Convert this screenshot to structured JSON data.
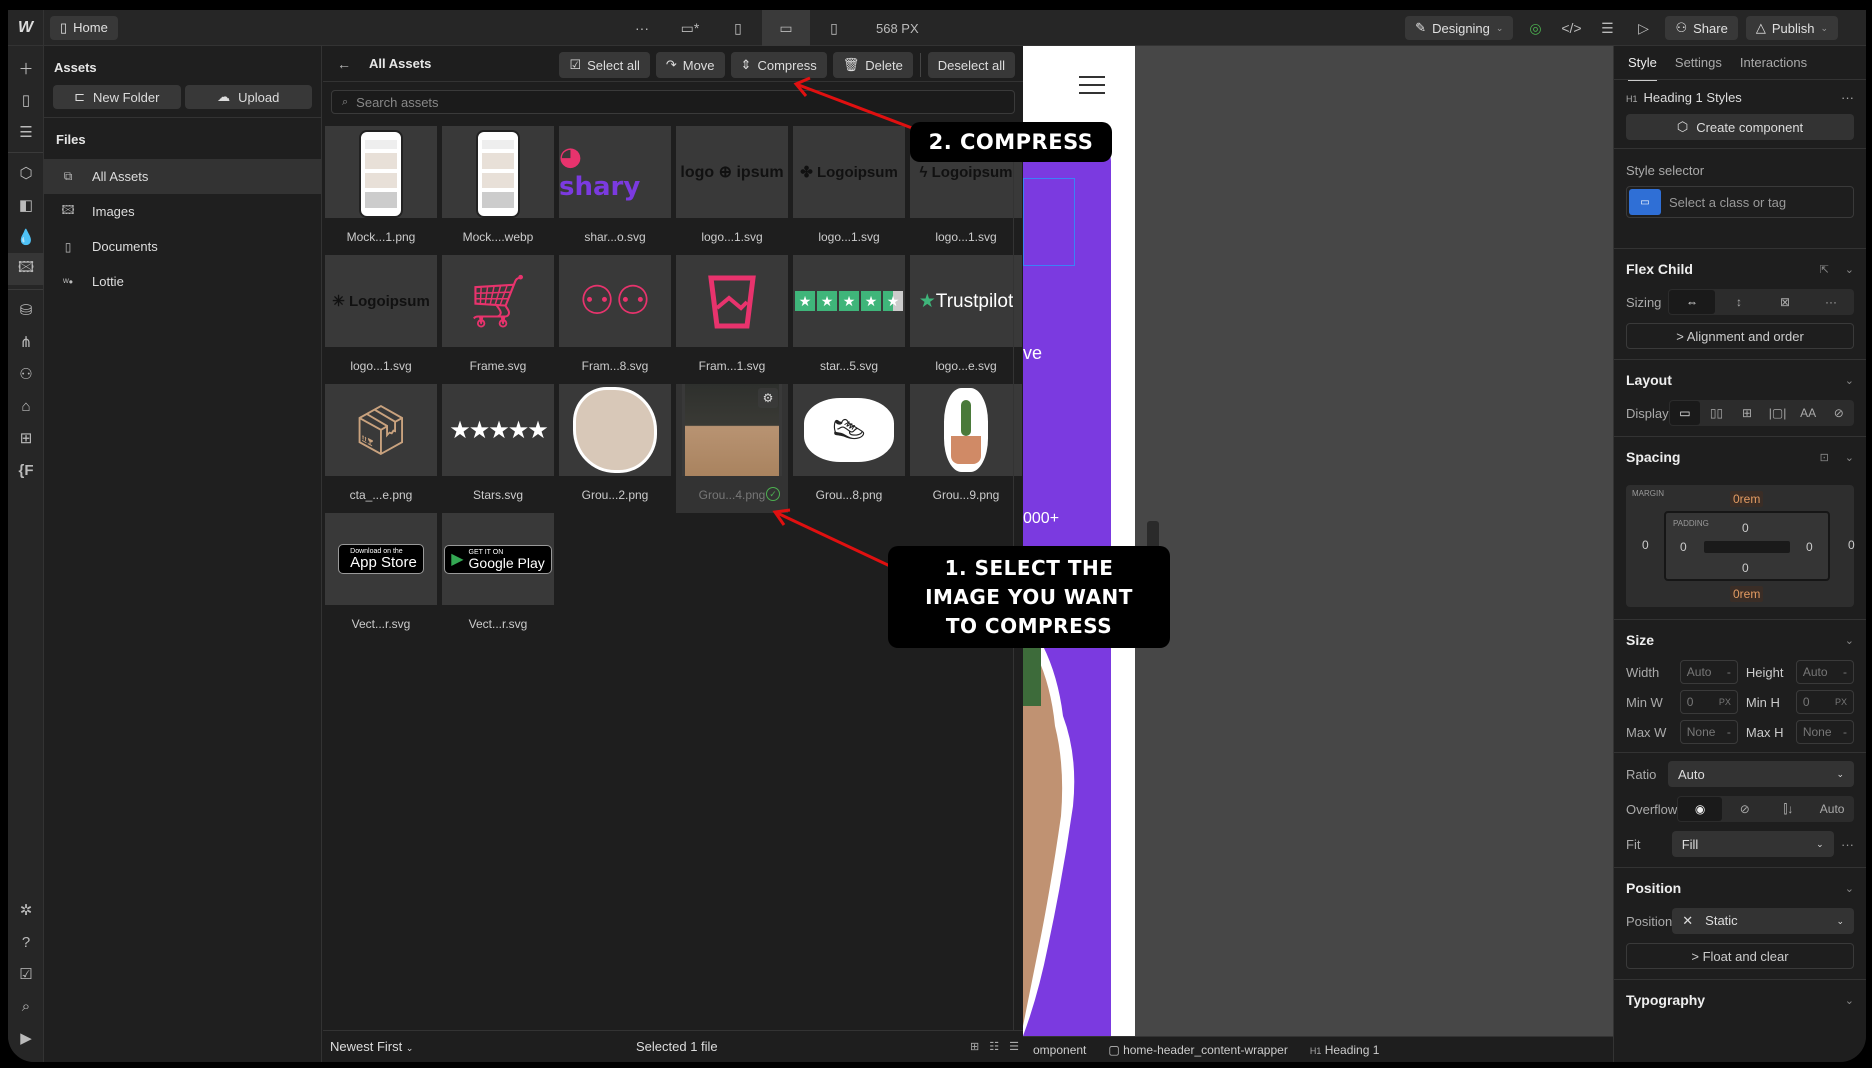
{
  "topbar": {
    "page_label": "Home",
    "more": "···",
    "width_readout": "568 PX",
    "mode_label": "Designing",
    "share_label": "Share",
    "publish_label": "Publish"
  },
  "assets_panel": {
    "title": "Assets",
    "new_folder_label": "New Folder",
    "upload_label": "Upload",
    "files_heading": "Files",
    "folders": [
      {
        "label": "All Assets",
        "icon": "stack-icon",
        "active": true
      },
      {
        "label": "Images",
        "icon": "image-icon",
        "active": false
      },
      {
        "label": "Documents",
        "icon": "document-icon",
        "active": false
      },
      {
        "label": "Lottie",
        "icon": "lottie-icon",
        "active": false
      }
    ]
  },
  "main": {
    "title": "All Assets",
    "actions": {
      "select_all": "Select all",
      "move": "Move",
      "compress": "Compress",
      "delete": "Delete",
      "deselect_all": "Deselect all"
    },
    "search_placeholder": "Search assets",
    "assets": [
      {
        "name": "Mock...1.png",
        "kind": "phone"
      },
      {
        "name": "Mock....webp",
        "kind": "phone"
      },
      {
        "name": "shar...o.svg",
        "kind": "shary"
      },
      {
        "name": "logo...1.svg",
        "kind": "logoipsum-globe"
      },
      {
        "name": "logo...1.svg",
        "kind": "logoipsum-clover"
      },
      {
        "name": "logo...1.svg",
        "kind": "logoipsum-bolt"
      },
      {
        "name": "logo...1.svg",
        "kind": "logoipsum-sun"
      },
      {
        "name": "Frame.svg",
        "kind": "cart"
      },
      {
        "name": "Fram...8.svg",
        "kind": "users"
      },
      {
        "name": "Fram...1.svg",
        "kind": "cup"
      },
      {
        "name": "star...5.svg",
        "kind": "trust-stars"
      },
      {
        "name": "logo...e.svg",
        "kind": "trustpilot"
      },
      {
        "name": "cta_...e.png",
        "kind": "box"
      },
      {
        "name": "Stars.svg",
        "kind": "white-stars"
      },
      {
        "name": "Grou...2.png",
        "kind": "couple"
      },
      {
        "name": "Grou...4.png",
        "kind": "boxes",
        "selected": true
      },
      {
        "name": "Grou...8.png",
        "kind": "sneakers"
      },
      {
        "name": "Grou...9.png",
        "kind": "cactus"
      },
      {
        "name": "Vect...r.svg",
        "kind": "appstore"
      },
      {
        "name": "Vect...r.svg",
        "kind": "googleplay"
      }
    ],
    "logo_texts": {
      "shary": "shary",
      "logo_a": "logo",
      "logo_b": "ipsum",
      "logoipsum": "Logoipsum",
      "trustpilot": "Trustpilot",
      "appstore_small": "Download on the",
      "appstore_big": "App Store",
      "gplay_small": "GET IT ON",
      "gplay_big": "Google Play"
    },
    "sort_label": "Newest First",
    "status": "Selected 1 file"
  },
  "canvas": {
    "text_a": "ve",
    "text_b": "000+"
  },
  "breadcrumbs": [
    {
      "label": "omponent",
      "icon": ""
    },
    {
      "label": "home-header_content-wrapper",
      "icon": "box-icon"
    },
    {
      "label": "Heading 1",
      "icon": "H1"
    }
  ],
  "style_panel": {
    "tabs": [
      "Style",
      "Settings",
      "Interactions"
    ],
    "active_tab": "Style",
    "element_tag": "H1",
    "element_label": "Heading 1 Styles",
    "create_component": "Create component",
    "style_selector_label": "Style selector",
    "style_selector_placeholder": "Select a class or tag",
    "flex_child": {
      "title": "Flex Child",
      "sizing_label": "Sizing",
      "alignment_label": "> Alignment and order"
    },
    "layout": {
      "title": "Layout",
      "display_label": "Display",
      "display_text_opt": "AA"
    },
    "spacing": {
      "title": "Spacing",
      "margin_label": "MARGIN",
      "padding_label": "PADDING",
      "margin_top": "0rem",
      "margin_bottom": "0rem",
      "margin_left": "0",
      "margin_right": "0",
      "padding_top": "0",
      "padding_bottom": "0",
      "padding_left": "0",
      "padding_right": "0"
    },
    "size": {
      "title": "Size",
      "width_label": "Width",
      "width": "Auto",
      "height_label": "Height",
      "height": "Auto",
      "minw_label": "Min W",
      "minw": "0",
      "minw_unit": "PX",
      "minh_label": "Min H",
      "minh": "0",
      "minh_unit": "PX",
      "maxw_label": "Max W",
      "maxw": "None",
      "maxh_label": "Max H",
      "maxh": "None",
      "unit_dash": "-",
      "ratio_label": "Ratio",
      "ratio": "Auto",
      "overflow_label": "Overflow",
      "overflow_auto": "Auto",
      "fit_label": "Fit",
      "fit": "Fill"
    },
    "position": {
      "title": "Position",
      "label": "Position",
      "value": "Static",
      "float_label": "> Float and clear"
    },
    "typography": {
      "title": "Typography"
    }
  },
  "annotations": {
    "step1": [
      "1. SELECT THE",
      "IMAGE YOU WANT",
      "TO COMPRESS"
    ],
    "step2": "2. COMPRESS",
    "arrow_color": "#e01010"
  },
  "colors": {
    "accent_purple": "#7b3ae0",
    "selector_blue": "#2f6fd6",
    "pink": "#e8336d",
    "trust_green": "#3fb57a"
  }
}
